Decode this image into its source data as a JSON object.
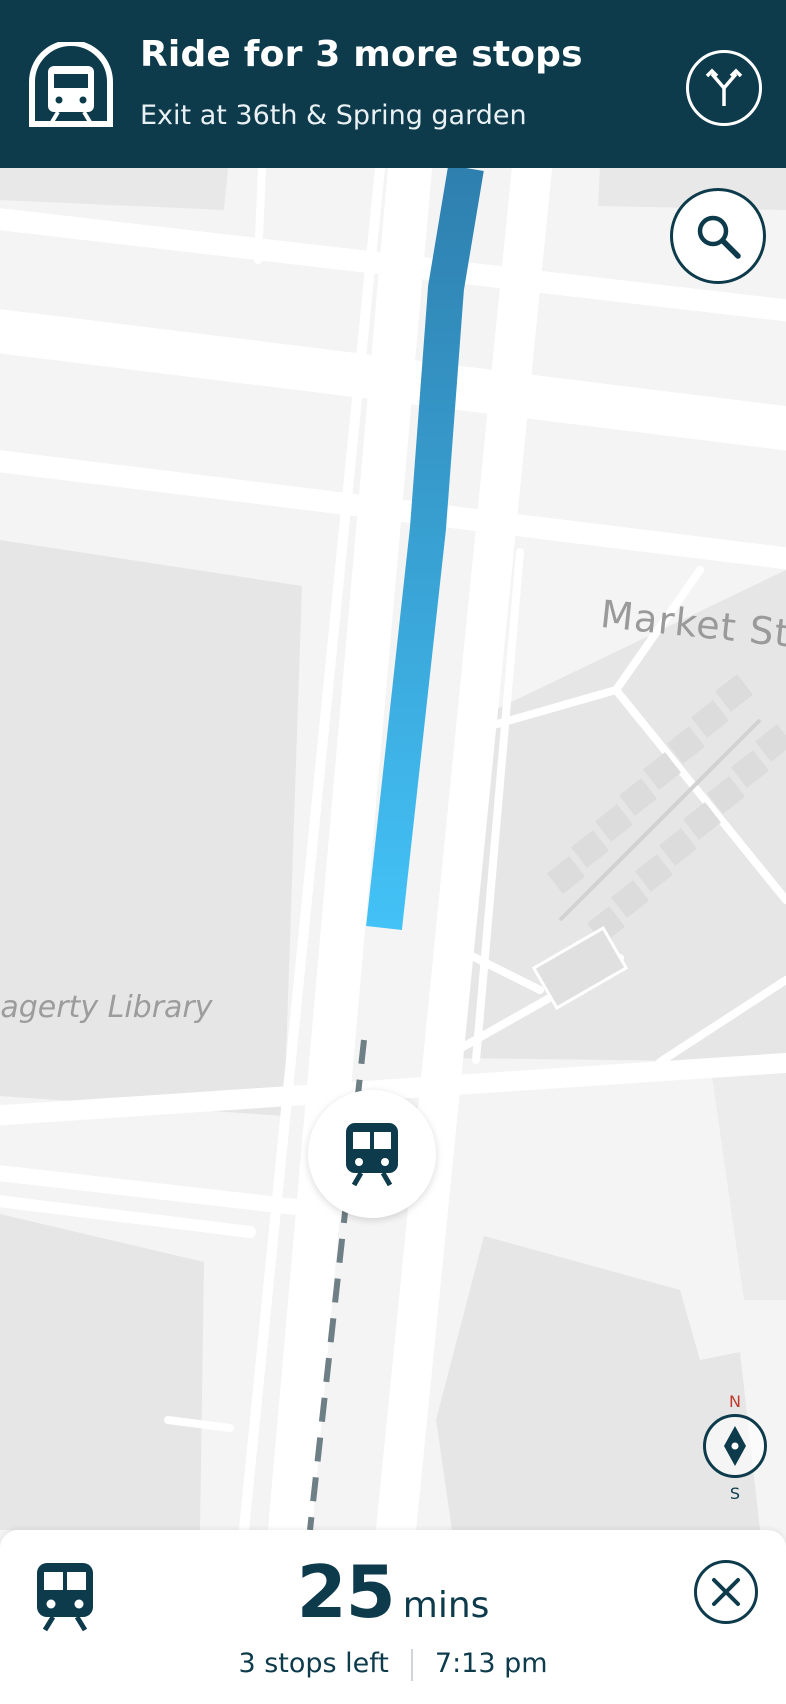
{
  "header": {
    "title": "Ride for 3 more stops",
    "subtitle": "Exit at 36th & Spring garden",
    "background": "#0d3b4b",
    "mode_icon": "train-icon",
    "action_icon": "route-fork-icon"
  },
  "map": {
    "street_label": "Market St",
    "poi_label": "lagerty Library",
    "route_color_start": "#2e86b5",
    "route_color_end": "#42c0f5",
    "search_icon": "search-icon",
    "stop_icon": "train-icon",
    "compass": {
      "north": "N",
      "south": "S"
    }
  },
  "trip": {
    "eta_value": "25",
    "eta_unit": "mins",
    "stops_left": "3 stops left",
    "arrival_time": "7:13 pm",
    "close_icon": "close-icon"
  }
}
